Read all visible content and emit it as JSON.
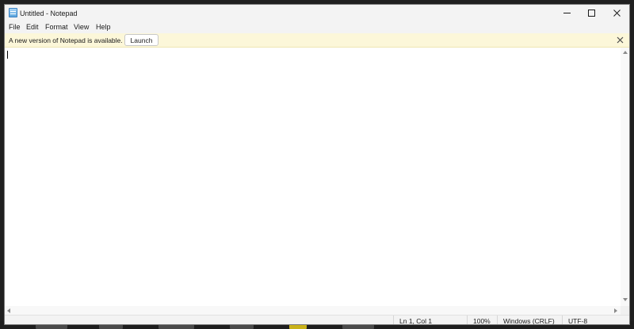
{
  "window": {
    "title": "Untitled - Notepad",
    "icon": "notepad-icon"
  },
  "caption_buttons": [
    "minimize-icon",
    "maximize-icon",
    "close-icon"
  ],
  "menu": {
    "items": [
      {
        "label": "File"
      },
      {
        "label": "Edit"
      },
      {
        "label": "Format"
      },
      {
        "label": "View"
      },
      {
        "label": "Help"
      }
    ]
  },
  "notification": {
    "message": "A new version of Notepad is available.",
    "action_label": "Launch",
    "close_icon": "close-icon",
    "background_color": "#fcf7d9"
  },
  "editor": {
    "content": ""
  },
  "status": {
    "position": "Ln 1, Col 1",
    "zoom": "100%",
    "line_ending": "Windows (CRLF)",
    "encoding": "UTF-8"
  }
}
